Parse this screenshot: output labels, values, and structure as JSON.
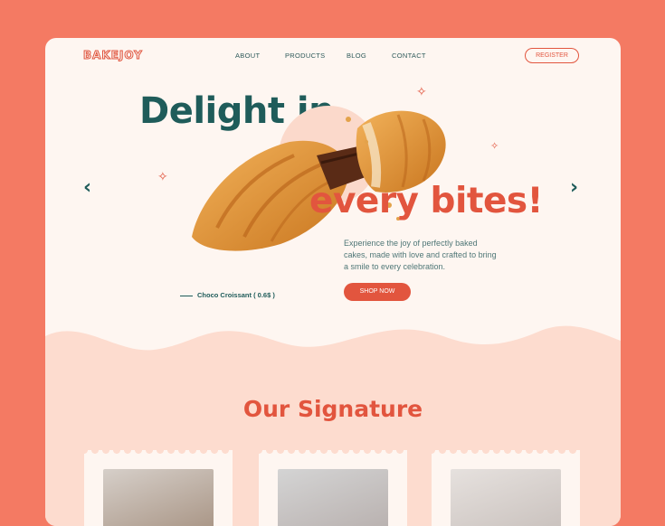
{
  "logo": "BAKEJOY",
  "nav": {
    "items": [
      "ABOUT",
      "PRODUCTS",
      "BLOG",
      "CONTACT"
    ],
    "register": "REGISTER"
  },
  "hero": {
    "title_line1": "Delight in",
    "title_line2": "every bites!",
    "description": "Experience the joy of perfectly baked cakes, made with love and crafted to bring a smile to every celebration.",
    "cta": "SHOP NOW",
    "product_label": "Choco Croissant ( 0.6$ )",
    "prev_icon": "chevron-left-icon",
    "next_icon": "chevron-right-icon"
  },
  "signature": {
    "title": "Our Signature"
  },
  "colors": {
    "background": "#F47A63",
    "accent": "#E2553E",
    "teal": "#1F5C5A",
    "cream": "#FEF6F1",
    "peach": "#FDDCCF"
  }
}
